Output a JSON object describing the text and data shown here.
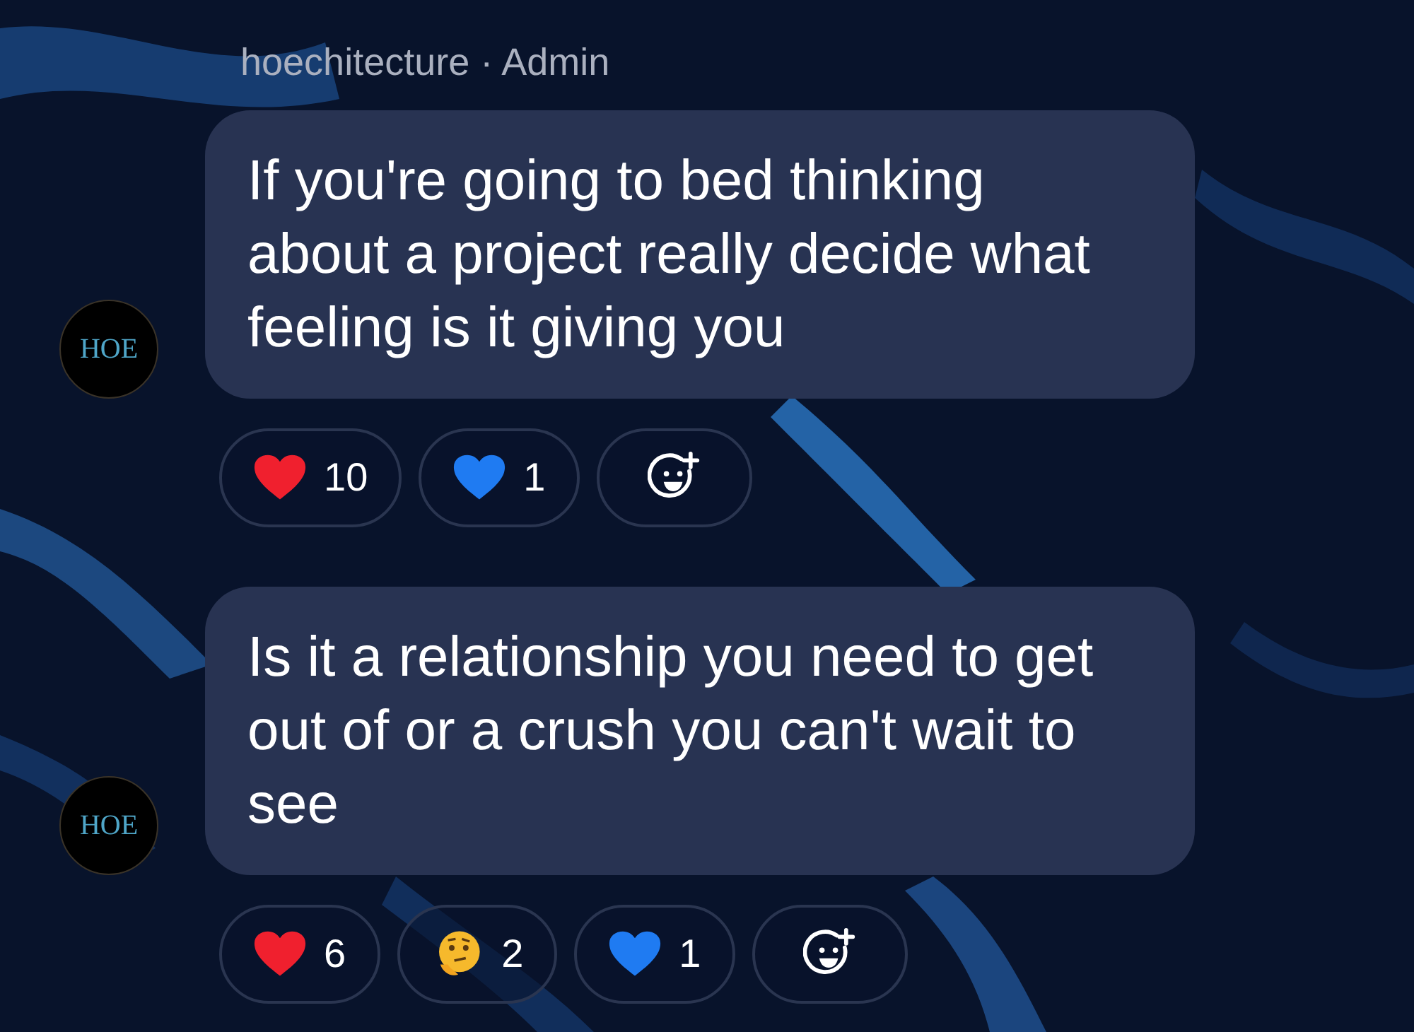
{
  "header": {
    "sender": "hoechitecture · Admin"
  },
  "messages": [
    {
      "avatar": "HOE",
      "text": "If you're going to bed thinking about a project really decide what feeling is it giving you",
      "reactions": [
        {
          "kind": "red-heart",
          "count": "10"
        },
        {
          "kind": "blue-heart",
          "count": "1"
        }
      ]
    },
    {
      "avatar": "HOE",
      "text": "Is it a relationship you need to get out of or a crush you can't wait to see",
      "reactions": [
        {
          "kind": "red-heart",
          "count": "6"
        },
        {
          "kind": "thinking",
          "count": "2"
        },
        {
          "kind": "blue-heart",
          "count": "1"
        }
      ]
    }
  ]
}
